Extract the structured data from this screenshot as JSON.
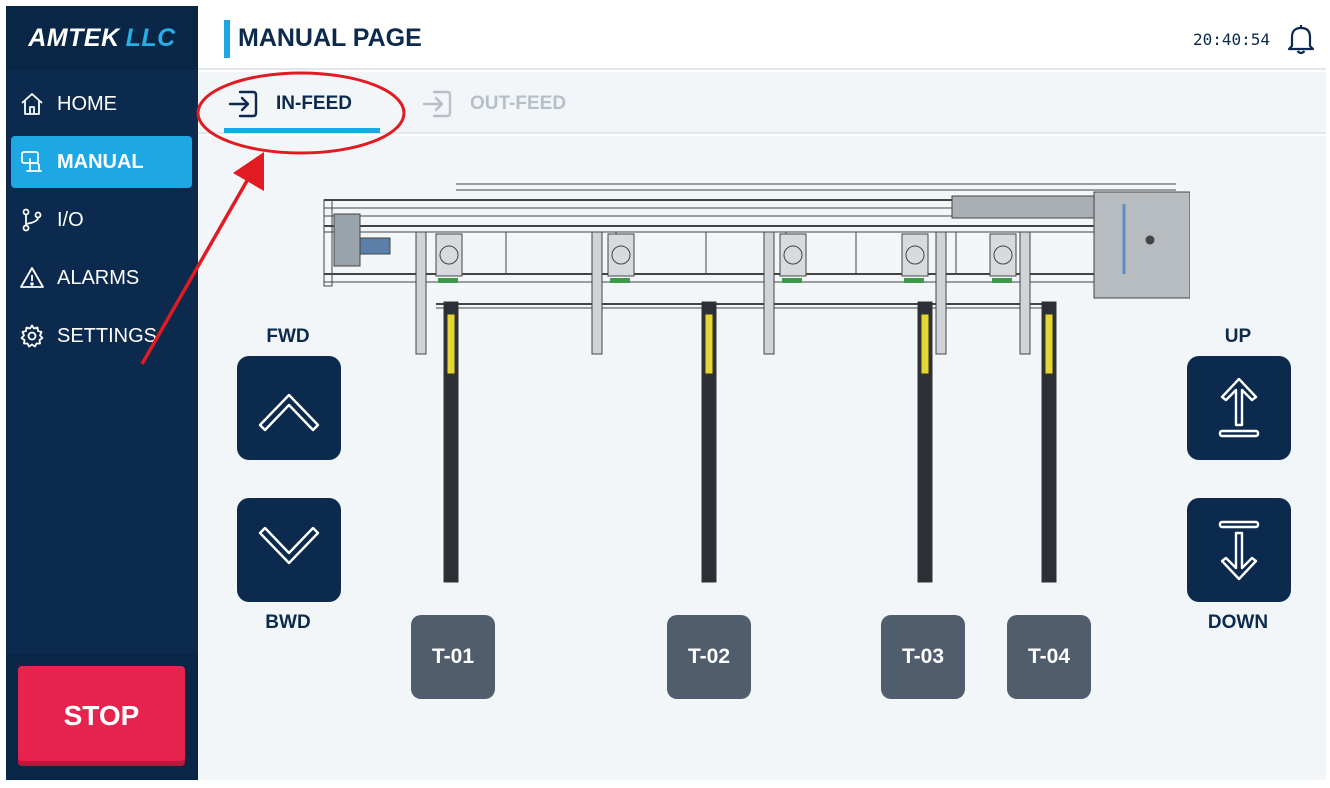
{
  "brand": {
    "part1": "AMTEK",
    "part2": "LLC"
  },
  "sidebar": {
    "items": [
      {
        "label": "HOME",
        "icon": "home-icon",
        "active": false
      },
      {
        "label": "MANUAL",
        "icon": "manual-icon",
        "active": true
      },
      {
        "label": "I/O",
        "icon": "io-branch-icon",
        "active": false
      },
      {
        "label": "ALARMS",
        "icon": "alarm-triangle-icon",
        "active": false
      },
      {
        "label": "SETTINGS",
        "icon": "gear-icon",
        "active": false
      }
    ],
    "stop_label": "STOP"
  },
  "header": {
    "title": "MANUAL PAGE",
    "time": "20:40:54"
  },
  "tabs": [
    {
      "label": "IN-FEED",
      "icon": "login-arrow-icon",
      "active": true
    },
    {
      "label": "OUT-FEED",
      "icon": "login-arrow-icon",
      "active": false
    }
  ],
  "controls": {
    "fwd_label": "FWD",
    "bwd_label": "BWD",
    "up_label": "UP",
    "down_label": "DOWN"
  },
  "towers": [
    "T-01",
    "T-02",
    "T-03",
    "T-04"
  ],
  "colors": {
    "sidebar": "#0b2a4d",
    "accent": "#1ea8e3",
    "stop": "#e6234c",
    "tower_button": "#505d6d",
    "annotation": "#e11b22"
  }
}
